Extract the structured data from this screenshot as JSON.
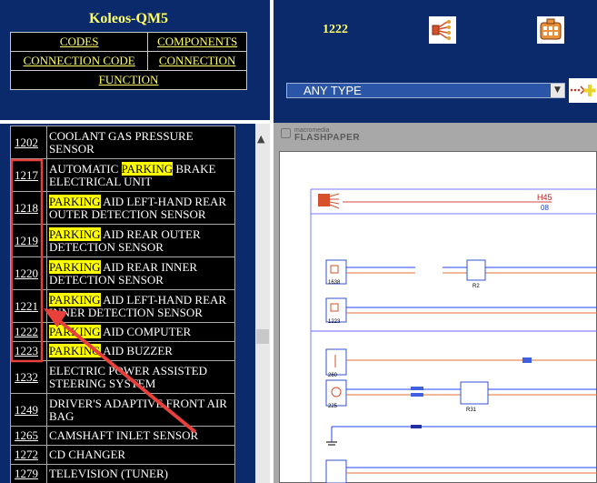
{
  "app": {
    "title": "Koleos-QM5"
  },
  "nav": {
    "codes": "CODES",
    "components": "COMPONENTS",
    "connection_code": "CONNECTION CODE",
    "connection": "CONNECTION",
    "function": "FUNCTION"
  },
  "components": [
    {
      "code": "1202",
      "parts": [
        {
          "t": "COOLANT GAS PRESSURE SENSOR",
          "h": false
        }
      ]
    },
    {
      "code": "1217",
      "parts": [
        {
          "t": "AUTOMATIC ",
          "h": false
        },
        {
          "t": "PARKING",
          "h": true
        },
        {
          "t": " BRAKE ELECTRICAL UNIT",
          "h": false
        }
      ]
    },
    {
      "code": "1218",
      "parts": [
        {
          "t": "PARKING",
          "h": true
        },
        {
          "t": " AID LEFT-HAND REAR OUTER DETECTION SENSOR",
          "h": false
        }
      ]
    },
    {
      "code": "1219",
      "parts": [
        {
          "t": "PARKING",
          "h": true
        },
        {
          "t": " AID REAR OUTER DETECTION SENSOR",
          "h": false
        }
      ]
    },
    {
      "code": "1220",
      "parts": [
        {
          "t": "PARKING",
          "h": true
        },
        {
          "t": " AID REAR INNER DETECTION SENSOR",
          "h": false
        }
      ]
    },
    {
      "code": "1221",
      "parts": [
        {
          "t": "PARKING",
          "h": true
        },
        {
          "t": " AID LEFT-HAND REAR INNER DETECTION SENSOR",
          "h": false
        }
      ]
    },
    {
      "code": "1222",
      "parts": [
        {
          "t": "PARKING",
          "h": true
        },
        {
          "t": " AID COMPUTER",
          "h": false
        }
      ]
    },
    {
      "code": "1223",
      "parts": [
        {
          "t": "PARKING",
          "h": true
        },
        {
          "t": " AID BUZZER",
          "h": false
        }
      ]
    },
    {
      "code": "1232",
      "parts": [
        {
          "t": "ELECTRIC POWER ASSISTED STEERING SYSTEM",
          "h": false
        }
      ]
    },
    {
      "code": "1249",
      "parts": [
        {
          "t": "DRIVER'S ADAPTIVE FRONT AIR BAG",
          "h": false
        }
      ]
    },
    {
      "code": "1265",
      "parts": [
        {
          "t": "CAMSHAFT INLET SENSOR",
          "h": false
        }
      ]
    },
    {
      "code": "1272",
      "parts": [
        {
          "t": "CD CHANGER",
          "h": false
        }
      ]
    },
    {
      "code": "1279",
      "parts": [
        {
          "t": "TELEVISION (TUNER)",
          "h": false
        }
      ]
    }
  ],
  "right_header": {
    "code": "1222",
    "wiring_icon": "wiring-harness-icon",
    "connector_icon": "connector-icon"
  },
  "filter": {
    "selected": "ANY TYPE"
  },
  "viewer": {
    "brand_small": "macromedia",
    "brand_big": "FLASHPAPER"
  },
  "diagram": {
    "header_label": "H45",
    "header_sub": "08",
    "ref_1": "1638",
    "ref_2": "1223",
    "ref_3": "260",
    "ref_4": "225",
    "ref_5": "R2",
    "ref_6": "R31"
  },
  "colors": {
    "frame_blue": "#0b2a6b",
    "title_yellow": "#ffff66",
    "highlight": "#ffff00",
    "annotation_red": "#e8403a"
  }
}
